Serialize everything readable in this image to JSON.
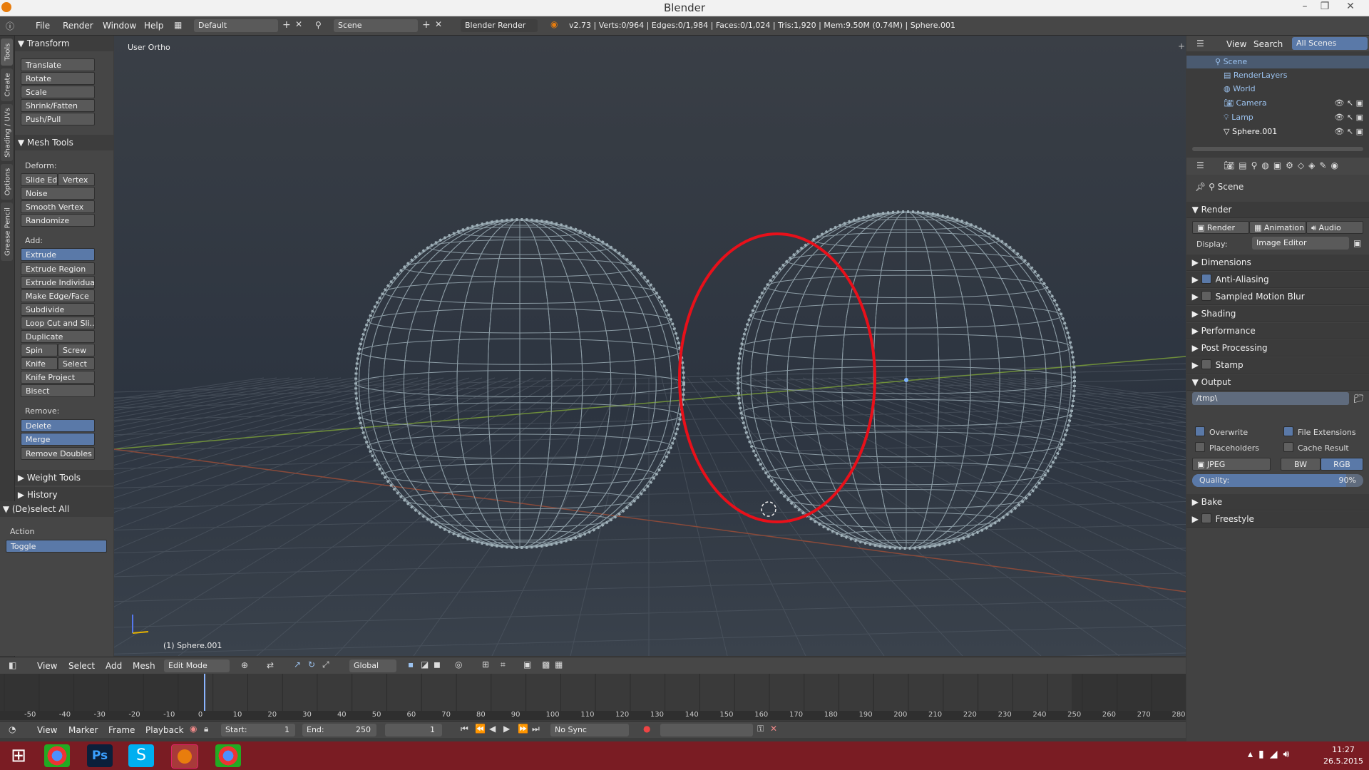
{
  "window": {
    "title": "Blender",
    "min": "–",
    "restore": "❐",
    "close": "✕"
  },
  "info": {
    "menus": [
      "File",
      "Render",
      "Window",
      "Help"
    ],
    "layout": "Default",
    "scene": "Scene",
    "engine": "Blender Render",
    "stats": "v2.73 | Verts:0/964 | Edges:0/1,984 | Faces:0/1,024 | Tris:1,920 | Mem:9.50M (0.74M) | Sphere.001"
  },
  "lefttabs": [
    "Tools",
    "Create",
    "Shading / UVs",
    "Options",
    "Grease Pencil"
  ],
  "toolshelf": {
    "transform": {
      "title": "Transform",
      "items": [
        "Translate",
        "Rotate",
        "Scale",
        "Shrink/Fatten",
        "Push/Pull"
      ]
    },
    "meshtools": {
      "title": "Mesh Tools",
      "deform_label": "Deform:",
      "slide_edge": "Slide Ed",
      "vertex": "Vertex",
      "noise": "Noise",
      "smooth_vertex": "Smooth Vertex",
      "randomize": "Randomize",
      "add_label": "Add:",
      "extrude": "Extrude",
      "extrude_region": "Extrude Region",
      "extrude_individual": "Extrude Individual",
      "make_edge_face": "Make Edge/Face",
      "subdivide": "Subdivide",
      "loop_cut": "Loop Cut and Sli...",
      "duplicate": "Duplicate",
      "spin": "Spin",
      "screw": "Screw",
      "knife": "Knife",
      "select": "Select",
      "knife_project": "Knife Project",
      "bisect": "Bisect",
      "remove_label": "Remove:",
      "delete": "Delete",
      "merge": "Merge",
      "remove_doubles": "Remove Doubles"
    },
    "weight_tools": "Weight Tools",
    "history": "History",
    "deselect": {
      "title": "(De)select All",
      "action_label": "Action",
      "action_value": "Toggle"
    }
  },
  "viewport": {
    "view_name": "User Ortho",
    "object_name": "(1) Sphere.001"
  },
  "vpheader": {
    "menus": [
      "View",
      "Select",
      "Add",
      "Mesh"
    ],
    "mode": "Edit Mode",
    "orientation": "Global"
  },
  "timeline": {
    "ticks": [
      "-50",
      "-40",
      "-30",
      "-20",
      "-10",
      "0",
      "10",
      "20",
      "30",
      "40",
      "50",
      "60",
      "70",
      "80",
      "90",
      "100",
      "110",
      "120",
      "130",
      "140",
      "150",
      "160",
      "170",
      "180",
      "190",
      "200",
      "210",
      "220",
      "230",
      "240",
      "250",
      "260",
      "270",
      "280"
    ],
    "menus": [
      "View",
      "Marker",
      "Frame",
      "Playback"
    ],
    "start_label": "Start:",
    "start_value": "1",
    "end_label": "End:",
    "end_value": "250",
    "current": "1",
    "sync": "No Sync"
  },
  "outliner": {
    "menus": [
      "View",
      "Search",
      "All Scenes"
    ],
    "rows": [
      "Scene",
      "RenderLayers",
      "World",
      "Camera",
      "Lamp",
      "Sphere.001"
    ]
  },
  "properties": {
    "context": "Scene",
    "render_title": "Render",
    "render_btn": "Render",
    "animation_btn": "Animation",
    "audio_btn": "Audio",
    "display_label": "Display:",
    "display_value": "Image Editor",
    "sections": [
      "Dimensions",
      "Anti-Aliasing",
      "Sampled Motion Blur",
      "Shading",
      "Performance",
      "Post Processing",
      "Stamp",
      "Output"
    ],
    "output_path": "/tmp\\",
    "overwrite": "Overwrite",
    "file_extensions": "File Extensions",
    "placeholders": "Placeholders",
    "cache_result": "Cache Result",
    "format": "JPEG",
    "bw": "BW",
    "rgb": "RGB",
    "quality_label": "Quality:",
    "quality_value": "90%",
    "quality": 0.9,
    "bake": "Bake",
    "freestyle": "Freestyle"
  },
  "taskbar": {
    "time": "11:27",
    "date": "26.5.2015",
    "ps_label": "Ps"
  }
}
